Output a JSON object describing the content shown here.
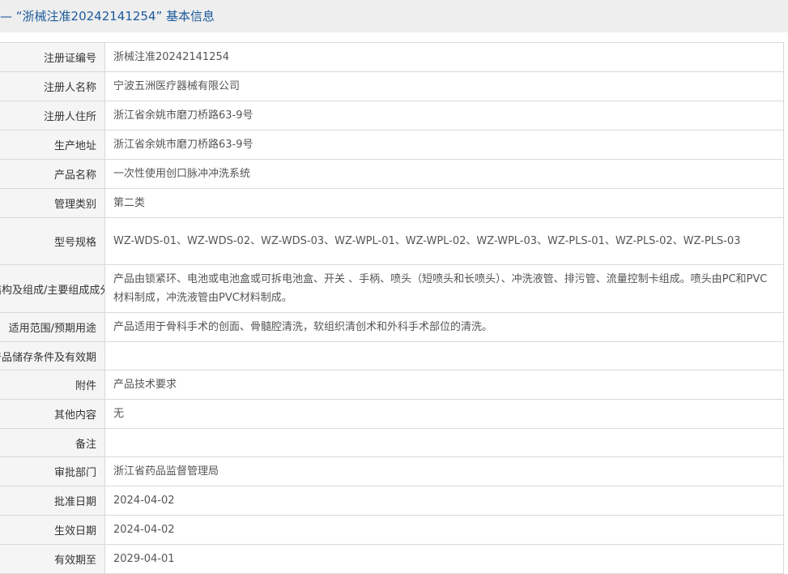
{
  "header": {
    "title": "—  “浙械注准20242141254”  基本信息"
  },
  "rows": [
    {
      "label": "注册证编号",
      "value": "浙械注准20242141254"
    },
    {
      "label": "注册人名称",
      "value": "宁波五洲医疗器械有限公司"
    },
    {
      "label": "注册人住所",
      "value": "浙江省余姚市磨刀桥路63-9号"
    },
    {
      "label": "生产地址",
      "value": "浙江省余姚市磨刀桥路63-9号"
    },
    {
      "label": "产品名称",
      "value": "一次性使用创口脉冲冲洗系统"
    },
    {
      "label": "管理类别",
      "value": "第二类"
    },
    {
      "label": "型号规格",
      "value": "WZ-WDS-01、WZ-WDS-02、WZ-WDS-03、WZ-WPL-01、WZ-WPL-02、WZ-WPL-03、WZ-PLS-01、WZ-PLS-02、WZ-PLS-03"
    },
    {
      "label": "结构及组成/主要组成成分",
      "value": "产品由锁紧环、电池或电池盒或可拆电池盒、开关 、手柄、喷头（短喷头和长喷头）、冲洗液管、排污管、流量控制卡组成。喷头由PC和PVC材料制成，冲洗液管由PVC材料制成。"
    },
    {
      "label": "适用范围/预期用途",
      "value": "产品适用于骨科手术的创面、骨髓腔清洗，软组织清创术和外科手术部位的清洗。"
    },
    {
      "label": "产品储存条件及有效期",
      "value": ""
    },
    {
      "label": "附件",
      "value": "产品技术要求"
    },
    {
      "label": "其他内容",
      "value": "无"
    },
    {
      "label": "备注",
      "value": ""
    },
    {
      "label": "审批部门",
      "value": "浙江省药品监督管理局"
    },
    {
      "label": "批准日期",
      "value": "2024-04-02"
    },
    {
      "label": "生效日期",
      "value": "2024-04-02"
    },
    {
      "label": "有效期至",
      "value": "2029-04-01"
    }
  ]
}
